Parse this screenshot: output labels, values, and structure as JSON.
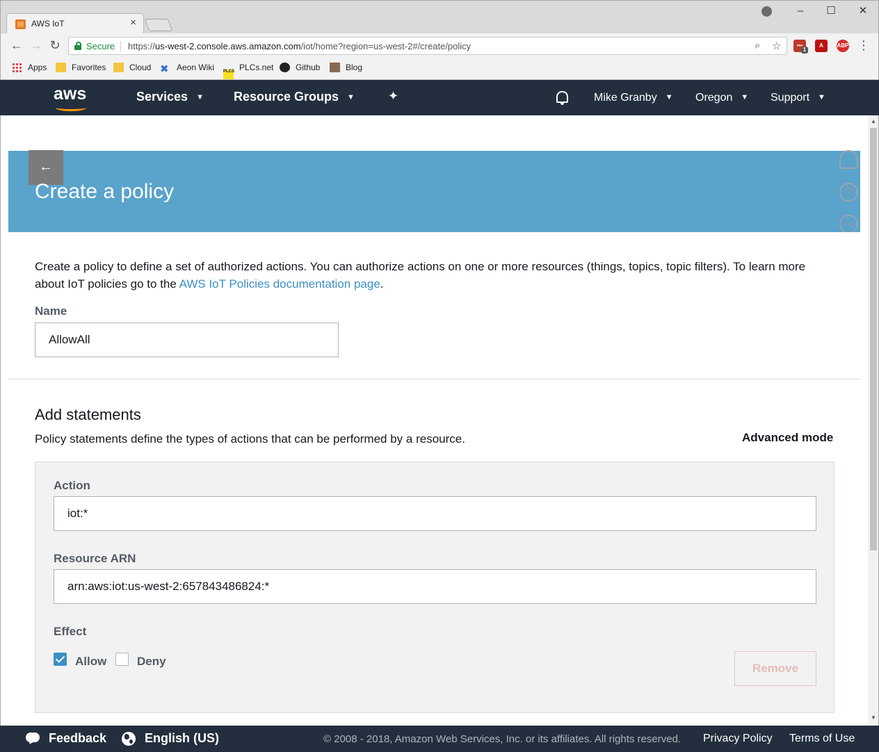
{
  "browser": {
    "tab_title": "AWS IoT",
    "tab_close": "×",
    "window_controls": {
      "minimize": "–",
      "maximize": "☐",
      "close": "✕"
    },
    "secure_label": "Secure",
    "url_scheme": "https://",
    "url_host": "us-west-2.console.aws.amazon.com",
    "url_path": "/iot/home?region=us-west-2#/create/policy",
    "extension_badge": "1",
    "bookmarks": [
      {
        "label": "Apps",
        "icon": "apps-grid-icon"
      },
      {
        "label": "Favorites",
        "icon": "folder-icon"
      },
      {
        "label": "Cloud",
        "icon": "folder-icon"
      },
      {
        "label": "Aeon Wiki",
        "icon": "confluence-icon"
      },
      {
        "label": "PLCs.net",
        "icon": "plcs-icon"
      },
      {
        "label": "Github",
        "icon": "github-icon"
      },
      {
        "label": "Blog",
        "icon": "blog-avatar-icon"
      }
    ]
  },
  "aws_header": {
    "logo": "aws",
    "nav": [
      {
        "label": "Services"
      },
      {
        "label": "Resource Groups"
      }
    ],
    "account": "Mike Granby",
    "region": "Oregon",
    "support": "Support"
  },
  "page": {
    "title": "Create a policy",
    "back_icon": "←",
    "intro_text": "Create a policy to define a set of authorized actions. You can authorize actions on one or more resources (things, topics, topic filters). To learn more about IoT policies go to the ",
    "intro_link": "AWS IoT Policies documentation page",
    "intro_end": ".",
    "name_label": "Name",
    "name_value": "AllowAll",
    "statements": {
      "heading": "Add statements",
      "description": "Policy statements define the types of actions that can be performed by a resource.",
      "advanced_mode": "Advanced mode",
      "action_label": "Action",
      "action_value": "iot:*",
      "resource_label": "Resource ARN",
      "resource_value": "arn:aws:iot:us-west-2:657843486824:*",
      "effect_label": "Effect",
      "allow_label": "Allow",
      "allow_checked": true,
      "deny_label": "Deny",
      "deny_checked": false,
      "remove_label": "Remove"
    }
  },
  "footer": {
    "feedback": "Feedback",
    "language": "English (US)",
    "copyright": "© 2008 - 2018, Amazon Web Services, Inc. or its affiliates. All rights reserved.",
    "privacy": "Privacy Policy",
    "terms": "Terms of Use"
  },
  "colors": {
    "aws_nav": "#232f3e",
    "banner": "#5aa3cb",
    "link": "#3d8fc3",
    "checkbox": "#3c8fc6"
  }
}
